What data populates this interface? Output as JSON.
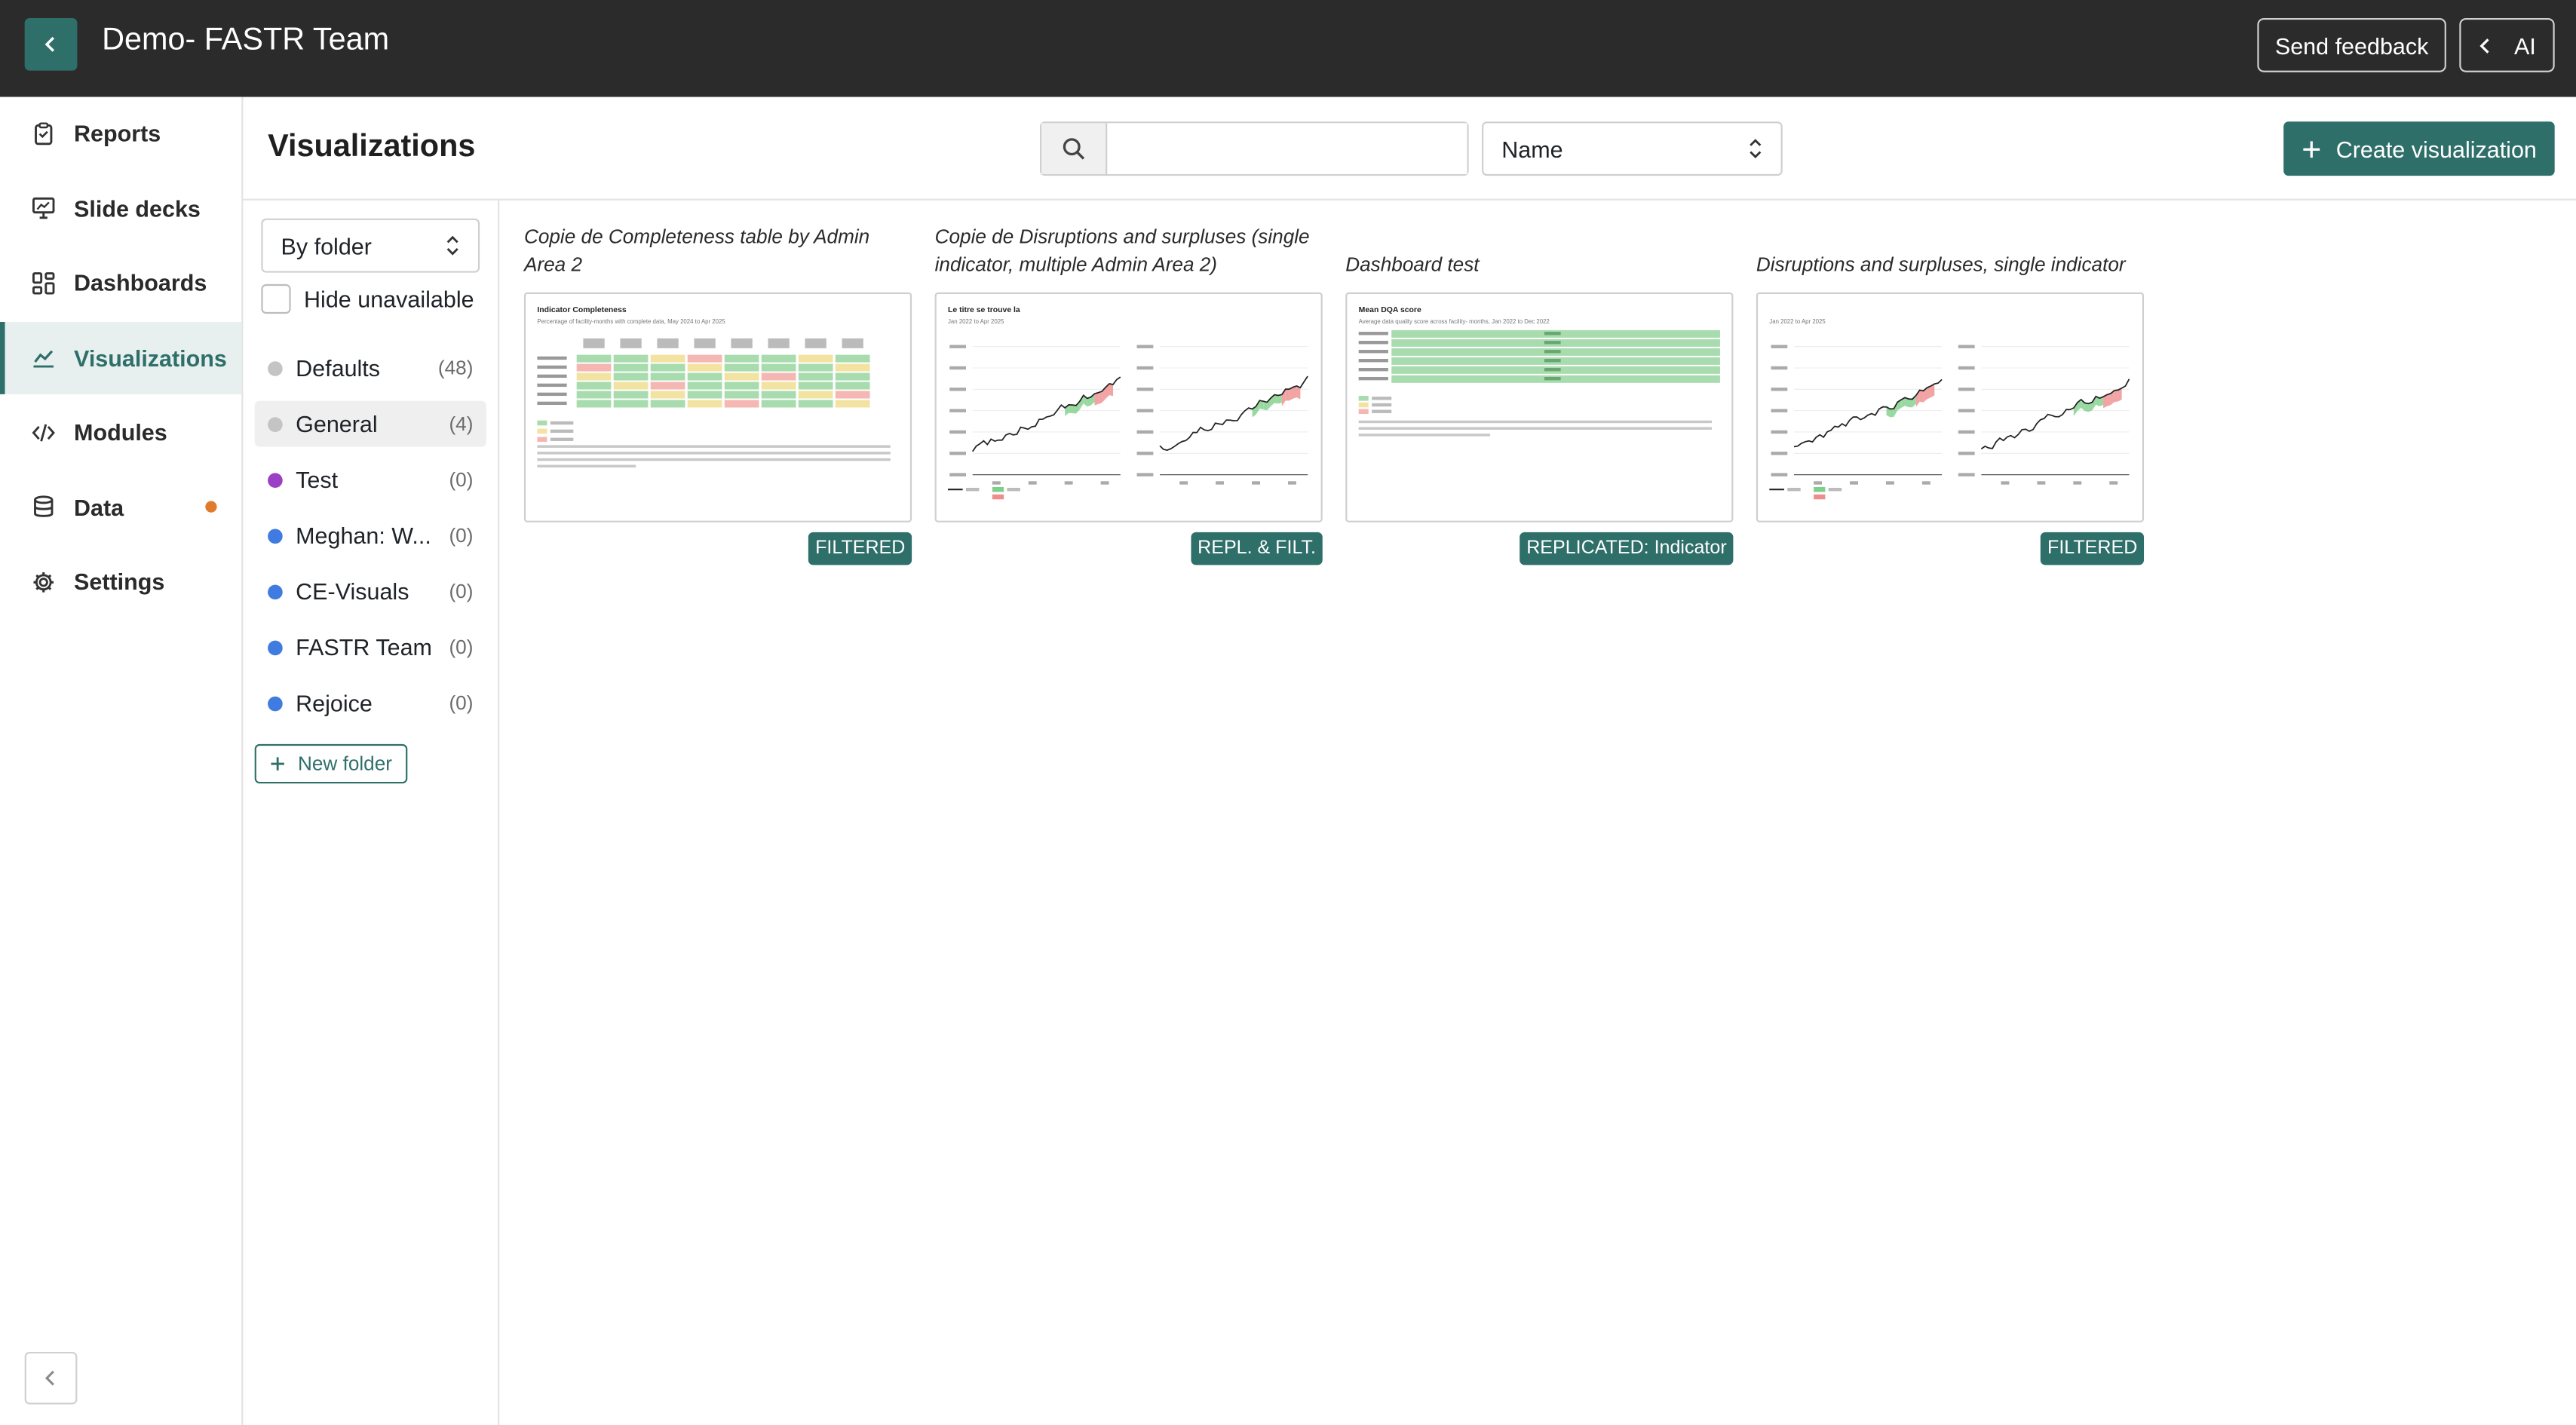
{
  "app": {
    "title": "Demo- FASTR Team",
    "send_feedback": "Send feedback",
    "ai_label": "AI"
  },
  "nav": {
    "items": [
      {
        "label": "Reports",
        "icon": "clipboard-icon"
      },
      {
        "label": "Slide decks",
        "icon": "presentation-icon"
      },
      {
        "label": "Dashboards",
        "icon": "dashboard-icon"
      },
      {
        "label": "Visualizations",
        "icon": "chart-line-icon",
        "active": true
      },
      {
        "label": "Modules",
        "icon": "code-icon"
      },
      {
        "label": "Data",
        "icon": "database-icon",
        "indicator_color": "#e07b2c"
      },
      {
        "label": "Settings",
        "icon": "gear-icon"
      }
    ]
  },
  "header": {
    "title": "Visualizations",
    "search": {
      "value": "",
      "placeholder": ""
    },
    "sort": {
      "selected": "Name"
    },
    "create_label": "Create visualization"
  },
  "folders": {
    "group_by": "By folder",
    "hide_unavailable_label": "Hide unavailable",
    "hide_unavailable_checked": false,
    "items": [
      {
        "name": "Defaults",
        "count": "(48)",
        "color": "#c4c4c4"
      },
      {
        "name": "General",
        "count": "(4)",
        "color": "#c4c4c4",
        "active": true
      },
      {
        "name": "Test",
        "count": "(0)",
        "color": "#9b3fc4"
      },
      {
        "name": "Meghan: W...",
        "count": "(0)",
        "color": "#3f7be0"
      },
      {
        "name": "CE-Visuals",
        "count": "(0)",
        "color": "#3f7be0"
      },
      {
        "name": "FASTR Team",
        "count": "(0)",
        "color": "#3f7be0"
      },
      {
        "name": "Rejoice",
        "count": "(0)",
        "color": "#3f7be0"
      }
    ],
    "new_folder_label": "New folder"
  },
  "cards": [
    {
      "title": "Copie de Completeness table by Admin Area 2",
      "badge": "FILTERED",
      "thumb": "table",
      "thumb_title": "Indicator Completeness",
      "thumb_subtitle": "Percentage of facility-months with complete data, May 2024 to Apr 2025"
    },
    {
      "title": "Copie de Disruptions and surpluses (single indicator, multiple Admin Area 2)",
      "badge": "REPL. & FILT.",
      "thumb": "lines",
      "thumb_title": "Le titre se trouve la",
      "thumb_subtitle": "Jan 2022 to Apr 2025"
    },
    {
      "title": "Dashboard test",
      "badge": "REPLICATED: Indicator",
      "thumb": "bars",
      "thumb_title": "Mean DQA score",
      "thumb_subtitle": "Average data quality score across facility- months, Jan 2022 to Dec 2022"
    },
    {
      "title": "Disruptions and surpluses, single indicator",
      "badge": "FILTERED",
      "thumb": "lines",
      "thumb_title": "",
      "thumb_subtitle": "Jan 2022 to Apr 2025"
    }
  ],
  "colors": {
    "accent": "#2f6f6a",
    "topbar": "#2b2b2b"
  }
}
